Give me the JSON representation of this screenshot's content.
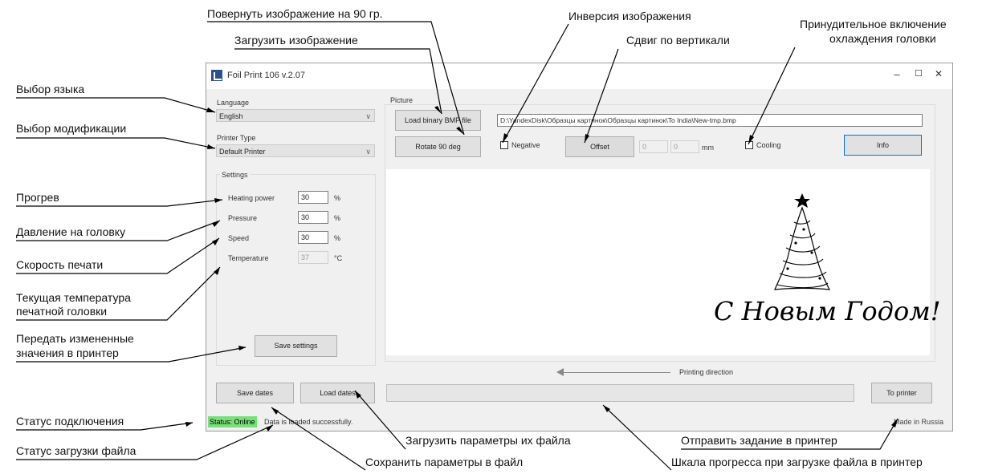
{
  "annotations": {
    "rotate": "Повернуть изображение на 90 гр.",
    "load_image": "Загрузить изображение",
    "invert": "Инверсия изображения",
    "vshift": "Сдвиг по вертикали",
    "cooling_line1": "Принудительное включение",
    "cooling_line2": "охлаждения головки",
    "language": "Выбор языка",
    "modification": "Выбор модификации",
    "heating": "Прогрев",
    "pressure": "Давление на головку",
    "speed": "Скорость печати",
    "temp_line1": "Текущая температура",
    "temp_line2": "печатной головки",
    "transfer_line1": "Передать измененные",
    "transfer_line2": "значения в принтер",
    "conn_status": "Статус подключения",
    "file_status": "Статус загрузки файла",
    "load_params": "Загрузить параметры их файла",
    "save_params": "Сохранить параметры в файл",
    "send_job": "Отправить задание в принтер",
    "progress_desc": "Шкала прогресса при загрузке файла в принтер"
  },
  "window": {
    "title": "Foil Print 106 v.2.07",
    "minimize": "–",
    "maximize": "☐",
    "close": "✕"
  },
  "left": {
    "language_label": "Language",
    "language_value": "English",
    "printer_type_label": "Printer Type",
    "printer_type_value": "Default Printer",
    "settings_label": "Settings",
    "heating_label": "Heating power",
    "heating_value": "30",
    "pressure_label": "Pressure",
    "pressure_value": "30",
    "speed_label": "Speed",
    "speed_value": "30",
    "temperature_label": "Temperature",
    "temperature_value": "37",
    "percent": "%",
    "celsius": "°C",
    "save_settings": "Save settings"
  },
  "picture": {
    "label": "Picture",
    "load_button": "Load binary BMP file",
    "path": "D:\\YandexDisk\\Образцы картинок\\Образцы картинок\\To India\\New-tmp.bmp",
    "rotate_button": "Rotate 90 deg",
    "negative_label": "Negative",
    "offset_button": "Offset",
    "offset_value1": "0",
    "offset_value2": "0",
    "offset_unit": "mm",
    "cooling_label": "Cooling",
    "info_button": "Info",
    "greeting": "С Новым Годом!",
    "printing_direction": "Printing direction"
  },
  "bottom": {
    "save_dates": "Save dates",
    "load_dates": "Load dates",
    "to_printer": "To printer",
    "progress": 0
  },
  "status": {
    "online": "Status: Online",
    "message": "Data is loaded successfully.",
    "made_in": "Made in Russia"
  },
  "colors": {
    "online_badge": "#79e079",
    "info_border": "#0078d7"
  }
}
